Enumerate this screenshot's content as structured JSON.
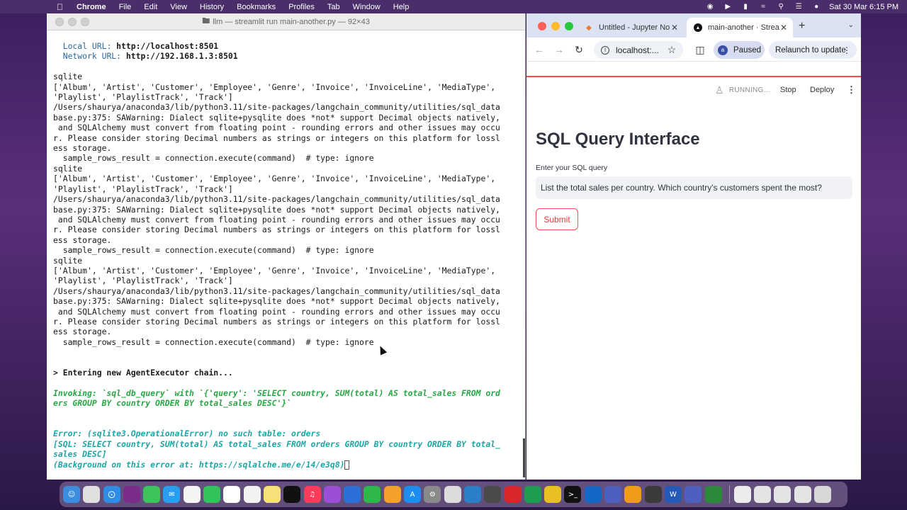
{
  "menubar": {
    "app": "Chrome",
    "items": [
      "File",
      "Edit",
      "View",
      "History",
      "Bookmarks",
      "Profiles",
      "Tab",
      "Window",
      "Help"
    ],
    "clock": "Sat 30 Mar  6:15 PM"
  },
  "terminal": {
    "title": "llm — streamlit run main-another.py — 92×43",
    "local_label": "Local URL:",
    "local_url": "http://localhost:8501",
    "network_label": "Network URL:",
    "network_url": "http://192.168.1.3:8501",
    "log_block": "sqlite\n['Album', 'Artist', 'Customer', 'Employee', 'Genre', 'Invoice', 'InvoiceLine', 'MediaType',\n'Playlist', 'PlaylistTrack', 'Track']\n/Users/shaurya/anaconda3/lib/python3.11/site-packages/langchain_community/utilities/sql_data\nbase.py:375: SAWarning: Dialect sqlite+pysqlite does *not* support Decimal objects natively,\n and SQLAlchemy must convert from floating point - rounding errors and other issues may occu\nr. Please consider storing Decimal numbers as strings or integers on this platform for lossl\ness storage.\n  sample_rows_result = connection.execute(command)  # type: ignore",
    "chain_line": "> Entering new AgentExecutor chain...",
    "invoking": "Invoking: `sql_db_query` with `{'query': 'SELECT country, SUM(total) AS total_sales FROM ord\ners GROUP BY country ORDER BY total_sales DESC'}`",
    "error": "Error: (sqlite3.OperationalError) no such table: orders\n[SQL: SELECT country, SUM(total) AS total_sales FROM orders GROUP BY country ORDER BY total_\nsales DESC]\n(Background on this error at: https://sqlalche.me/e/14/e3q8)"
  },
  "browser": {
    "tabs": [
      {
        "label": "Untitled - Jupyter No",
        "icon": "jupyter-icon"
      },
      {
        "label": "main-another · Strea",
        "icon": "streamlit-icon"
      }
    ],
    "address": "localhost:...",
    "profile_initial": "a",
    "paused_label": "Paused",
    "relaunch_label": "Relaunch to update"
  },
  "streamlit": {
    "status": "RUNNING...",
    "stop_label": "Stop",
    "deploy_label": "Deploy",
    "title": "SQL Query Interface",
    "input_label": "Enter your SQL query",
    "input_value": "List the total sales per country. Which country's customers spent the most?",
    "submit_label": "Submit"
  },
  "colors": {
    "accent": "#ff4b4b",
    "green_log": "#28a745",
    "teal_log": "#1ba6a6"
  }
}
